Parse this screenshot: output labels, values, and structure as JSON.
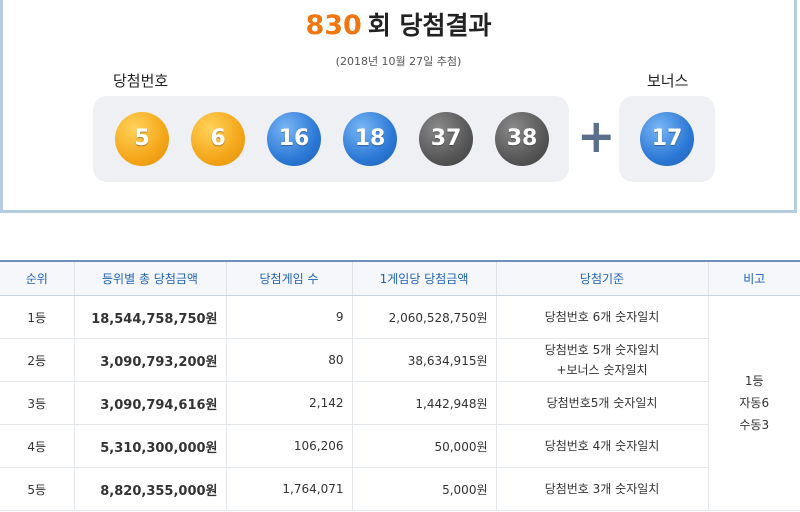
{
  "result": {
    "round_number": "830",
    "round_suffix": "회 당첨결과",
    "draw_date": "(2018년 10월 27일 추첨)",
    "winning_label": "당첨번호",
    "bonus_label": "보너스",
    "plus_symbol": "+",
    "winning_numbers": [
      "5",
      "6",
      "16",
      "18",
      "37",
      "38"
    ],
    "bonus_number": "17",
    "ball_colors": {
      "yellow": "#f4a619",
      "blue": "#2c79d6",
      "gray": "#575757"
    }
  },
  "table": {
    "headers": [
      "순위",
      "등위별 총 당첨금액",
      "당첨게임 수",
      "1게임당 당첨금액",
      "당첨기준",
      "비고"
    ],
    "rows": [
      {
        "rank": "1등",
        "total": "18,544,758,750원",
        "count": "9",
        "each": "2,060,528,750원",
        "criteria_1": "당첨번호 6개 숫자일치",
        "criteria_2": ""
      },
      {
        "rank": "2등",
        "total": "3,090,793,200원",
        "count": "80",
        "each": "38,634,915원",
        "criteria_1": "당첨번호 5개 숫자일치",
        "criteria_2": "+보너스 숫자일치"
      },
      {
        "rank": "3등",
        "total": "3,090,794,616원",
        "count": "2,142",
        "each": "1,442,948원",
        "criteria_1": "당첨번호5개 숫자일치",
        "criteria_2": ""
      },
      {
        "rank": "4등",
        "total": "5,310,300,000원",
        "count": "106,206",
        "each": "50,000원",
        "criteria_1": "당첨번호 4개 숫자일치",
        "criteria_2": ""
      },
      {
        "rank": "5등",
        "total": "8,820,355,000원",
        "count": "1,764,071",
        "each": "5,000원",
        "criteria_1": "당첨번호 3개 숫자일치",
        "criteria_2": ""
      }
    ],
    "note": {
      "line1": "1등",
      "line2": "자동6",
      "line3": "수동3"
    }
  }
}
